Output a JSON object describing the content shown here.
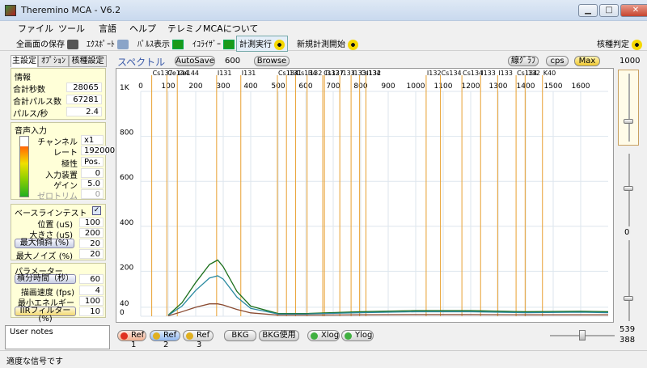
{
  "app": {
    "title": "Theremino MCA - V6.2"
  },
  "window_buttons": {
    "min": "▁",
    "max": "□",
    "close": "✕"
  },
  "menu": [
    "ファイル",
    "ツール",
    "言語",
    "ヘルプ",
    "テレミノMCAについて"
  ],
  "toolbar": {
    "save_all": "全画面の保存",
    "export": "ｴｸｽﾎﾟｰﾄ",
    "pulse_display": "ﾊﾟﾙｽ表示",
    "equalizer": "ｲｺﾗｲｻﾞｰ",
    "run": "計測実行",
    "new_start": "新規計測開始",
    "nuclide": "核種判定"
  },
  "tabs": [
    "主設定",
    "ｵﾌﾟｼｮﾝ",
    "核種設定"
  ],
  "info": {
    "title": "情報",
    "rows": [
      {
        "label": "合計秒数",
        "value": "28065"
      },
      {
        "label": "合計パルス数",
        "value": "67281"
      },
      {
        "label": "パルス/秒",
        "value": "2.4"
      }
    ]
  },
  "audio": {
    "title": "音声入力",
    "rows": [
      {
        "label": "チャンネル",
        "value": "x1"
      },
      {
        "label": "レート",
        "value": "192000"
      },
      {
        "label": "極性",
        "value": "Pos."
      },
      {
        "label": "入力装置",
        "value": "0"
      },
      {
        "label": "ゲイン",
        "value": "5.0"
      },
      {
        "label": "ゼロトリム",
        "value": "0"
      }
    ]
  },
  "baseline": {
    "title": "ベースラインテスト",
    "checked": "✓",
    "rows": [
      {
        "label": "位置 (uS)",
        "value": "100"
      },
      {
        "label": "大きさ (uS)",
        "value": "200"
      },
      {
        "label": "最大傾斜 (%)",
        "value": "20"
      },
      {
        "label": "最大ノイズ (%)",
        "value": "20"
      }
    ]
  },
  "params": {
    "title": "パラメーター",
    "rows": [
      {
        "label": "積分時間（秒）",
        "value": "60"
      },
      {
        "label": "描画速度 (fps)",
        "value": "4"
      },
      {
        "label": "最小エネルギー",
        "value": "100"
      },
      {
        "label": "IIRフィルター (%)",
        "value": "10"
      }
    ]
  },
  "user_notes": "User notes",
  "status_text": "適度な信号です",
  "spectrum": {
    "label": "スペクトル",
    "autosave": "AutoSave",
    "autosave_value": "600",
    "browse": "Browse",
    "line_graph": "線ｸﾞﾗﾌ",
    "cps": "cps",
    "max": "Max"
  },
  "right": {
    "top_value": "1000",
    "mid_value": "0",
    "b1": "539",
    "b2": "388"
  },
  "bottom": {
    "ref1": "Ref 1",
    "ref2": "Ref 2",
    "ref3": "Ref 3",
    "bkg": "BKG",
    "bkg_use": "BKG使用",
    "xlog": "Xlog",
    "ylog": "Ylog"
  },
  "chart_data": {
    "type": "line",
    "xlim": [
      0,
      1700
    ],
    "ylim": [
      0,
      1000
    ],
    "x_ticks": [
      0,
      100,
      200,
      300,
      400,
      500,
      600,
      700,
      800,
      900,
      1000,
      1100,
      1200,
      1300,
      1400,
      1500,
      1600
    ],
    "y_ticks": [
      {
        "v": 1000,
        "t": "1K"
      },
      {
        "v": 800,
        "t": "800"
      },
      {
        "v": 600,
        "t": "600"
      },
      {
        "v": 400,
        "t": "400"
      },
      {
        "v": 200,
        "t": "200"
      },
      {
        "v": 40,
        "t": "40"
      },
      {
        "v": 0,
        "t": "0"
      }
    ],
    "markers": [
      {
        "x": 40,
        "t": "Cs137"
      },
      {
        "x": 95,
        "t": "Ce144"
      },
      {
        "x": 133,
        "t": "Ce144"
      },
      {
        "x": 276,
        "t": "I131"
      },
      {
        "x": 364,
        "t": "I131"
      },
      {
        "x": 497,
        "t": "Cs134"
      },
      {
        "x": 530,
        "t": "I131"
      },
      {
        "x": 563,
        "t": "Cs134"
      },
      {
        "x": 605,
        "t": "I132"
      },
      {
        "x": 662,
        "t": "Cs137"
      },
      {
        "x": 668,
        "t": "I132"
      },
      {
        "x": 724,
        "t": "I133"
      },
      {
        "x": 765,
        "t": "I133"
      },
      {
        "x": 796,
        "t": "Cs134"
      },
      {
        "x": 819,
        "t": "I132"
      },
      {
        "x": 1038,
        "t": "I132"
      },
      {
        "x": 1090,
        "t": "Cs134"
      },
      {
        "x": 1168,
        "t": "Cs134"
      },
      {
        "x": 1236,
        "t": "I133"
      },
      {
        "x": 1298,
        "t": "I133"
      },
      {
        "x": 1365,
        "t": "Cs134"
      },
      {
        "x": 1398,
        "t": "I132"
      },
      {
        "x": 1461,
        "t": "K40"
      }
    ],
    "series": [
      {
        "color": "#1a6e1a",
        "x": [
          100,
          150,
          200,
          250,
          280,
          300,
          350,
          400,
          500,
          600,
          800,
          1000,
          1200,
          1400,
          1600,
          1700
        ],
        "y": [
          5,
          60,
          150,
          230,
          250,
          220,
          110,
          45,
          12,
          12,
          20,
          25,
          25,
          20,
          22,
          20
        ]
      },
      {
        "color": "#2a8aa0",
        "x": [
          100,
          150,
          200,
          250,
          280,
          300,
          350,
          400,
          500,
          600,
          800,
          1000,
          1200,
          1400,
          1600,
          1700
        ],
        "y": [
          4,
          45,
          115,
          170,
          180,
          165,
          85,
          35,
          10,
          10,
          16,
          20,
          20,
          16,
          18,
          16
        ]
      },
      {
        "color": "#8a4a30",
        "x": [
          100,
          150,
          200,
          250,
          280,
          300,
          350,
          400,
          500,
          600,
          800,
          1000,
          1200,
          1400,
          1600,
          1700
        ],
        "y": [
          2,
          20,
          40,
          55,
          55,
          50,
          30,
          15,
          5,
          5,
          6,
          7,
          7,
          6,
          6,
          6
        ]
      }
    ]
  }
}
